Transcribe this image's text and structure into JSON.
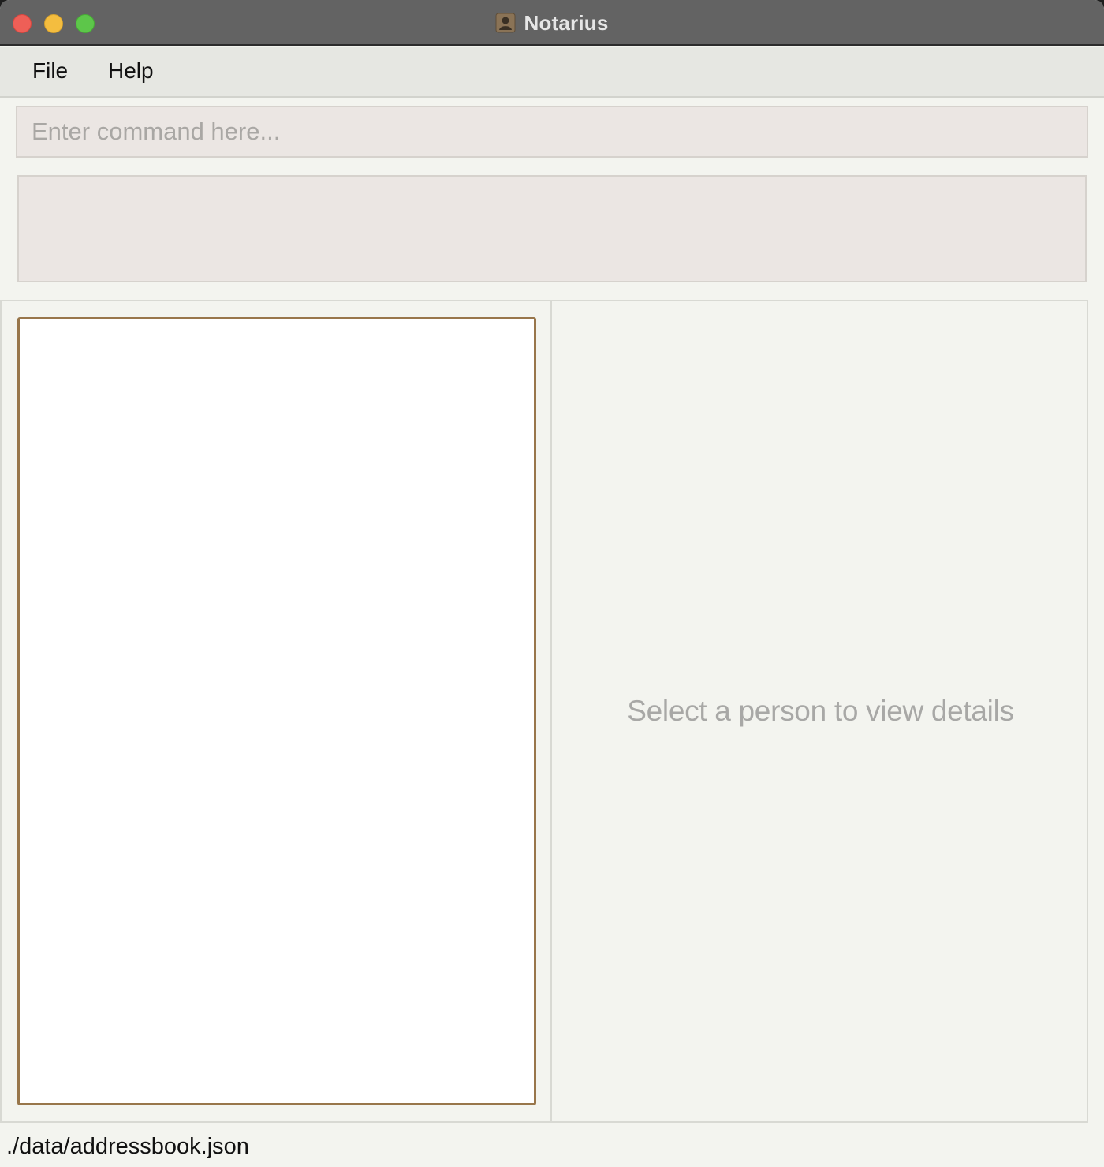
{
  "window": {
    "title": "Notarius",
    "app_icon": "contact-book-icon"
  },
  "menu": {
    "items": [
      {
        "label": "File"
      },
      {
        "label": "Help"
      }
    ]
  },
  "command": {
    "value": "",
    "placeholder": "Enter command here..."
  },
  "result": {
    "text": ""
  },
  "person_list": {
    "items": []
  },
  "details": {
    "placeholder": "Select a person to view details"
  },
  "status": {
    "file_path": "./data/addressbook.json"
  },
  "colors": {
    "titlebar": "#636363",
    "list_border": "#98764b",
    "close": "#ee5f57",
    "minimize": "#f4bd3f",
    "maximize": "#5dc64a"
  }
}
